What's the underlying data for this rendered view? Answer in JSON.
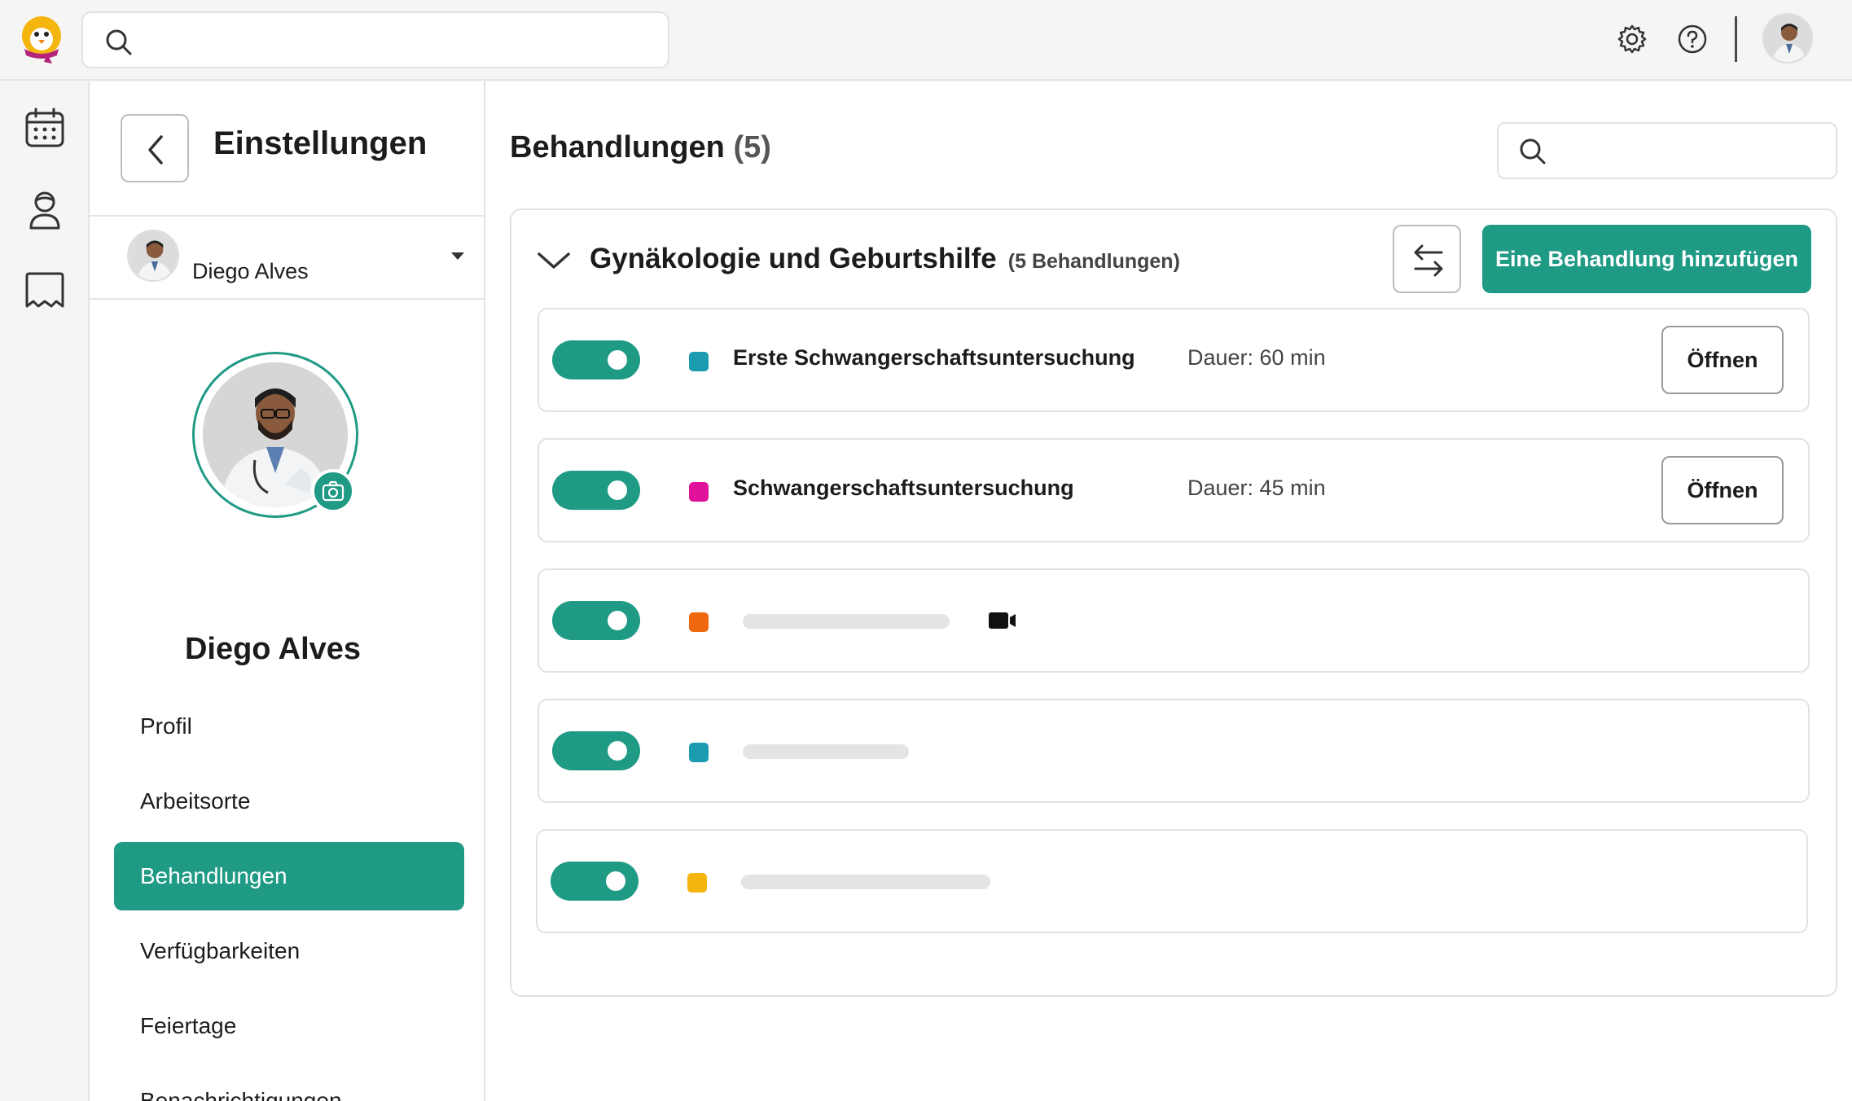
{
  "app": {
    "brand_color": "#1f9a85",
    "logo": "penguin-logo"
  },
  "header": {
    "search_placeholder": ""
  },
  "settings": {
    "title": "Einstellungen",
    "selected_user": "Diego Alves",
    "profile_name": "Diego Alves",
    "nav": [
      {
        "label": "Profil",
        "active": false
      },
      {
        "label": "Arbeitsorte",
        "active": false
      },
      {
        "label": "Behandlungen",
        "active": true
      },
      {
        "label": "Verfügbarkeiten",
        "active": false
      },
      {
        "label": "Feiertage",
        "active": false
      },
      {
        "label": "Benachrichtigungen",
        "active": false
      }
    ]
  },
  "main": {
    "title": "Behandlungen",
    "count": "(5)",
    "search_placeholder": "",
    "group": {
      "title": "Gynäkologie und Geburtshilfe",
      "subtitle": "(5 Behandlungen)",
      "add_label": "Eine Behandlung hinzufügen"
    },
    "treatments": [
      {
        "name": "Erste Schwangerschaftsuntersuchung",
        "duration": "Dauer: 60 min",
        "color": "#1a9bb0",
        "enabled": true,
        "open_label": "Öffnen"
      },
      {
        "name": "Schwangerschaftsuntersuchung",
        "duration": "Dauer: 45 min",
        "color": "#e0119b",
        "enabled": true,
        "open_label": "Öffnen"
      },
      {
        "name": "",
        "color": "#f0690f",
        "enabled": true,
        "video": true
      },
      {
        "name": "",
        "color": "#1a9bb0",
        "enabled": true
      },
      {
        "name": "",
        "color": "#f5b50f",
        "enabled": true
      }
    ]
  }
}
